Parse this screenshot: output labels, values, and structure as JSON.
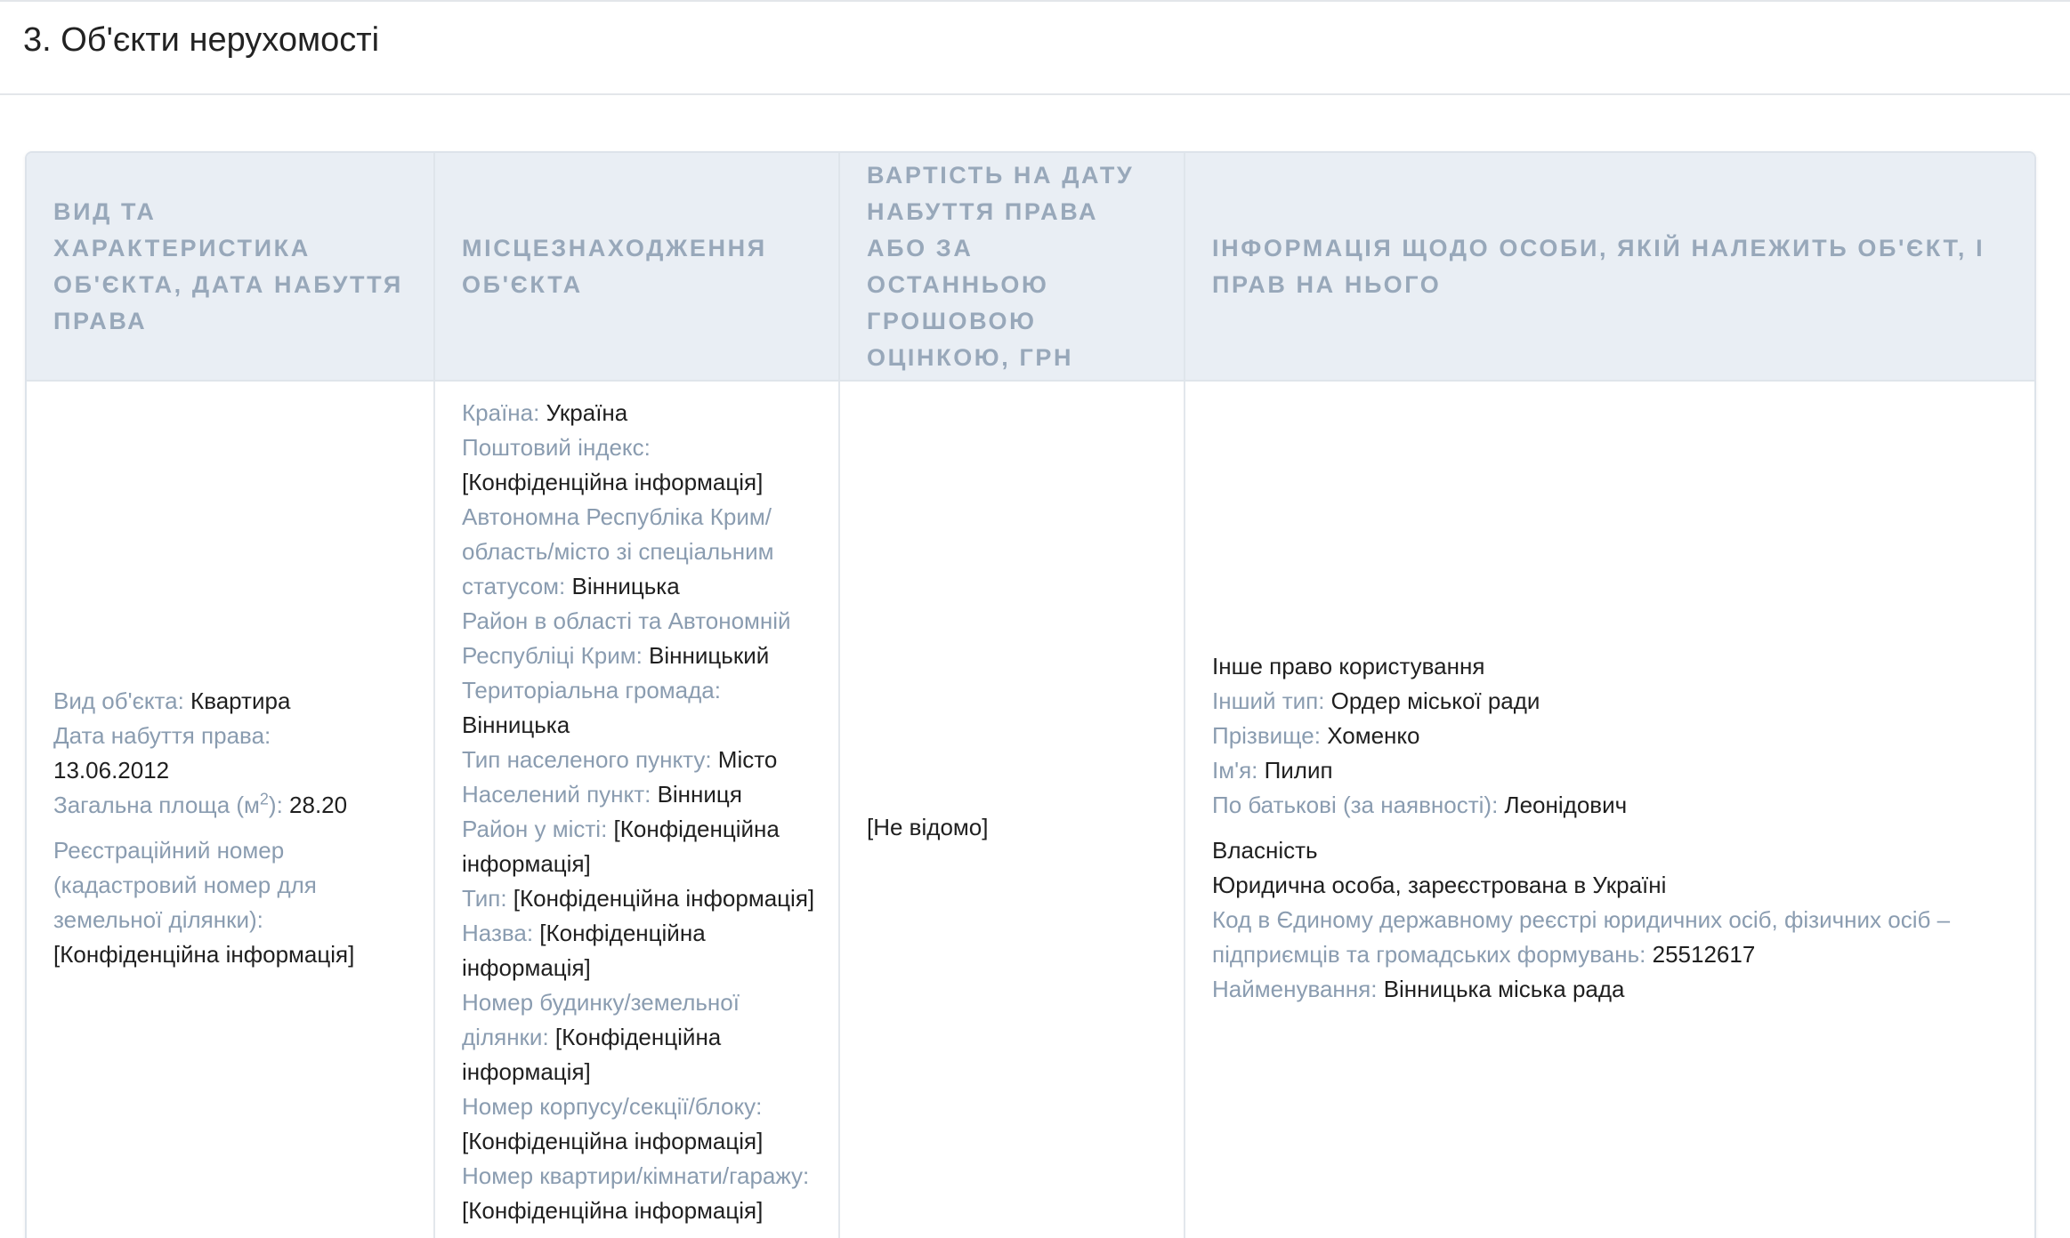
{
  "section": {
    "title": "3. Об'єкти нерухомості"
  },
  "table": {
    "headers": [
      "ВИД ТА ХАРАКТЕРИСТИКА ОБ'ЄКТА, ДАТА НАБУТТЯ ПРАВА",
      "МІСЦЕЗНАХОДЖЕННЯ ОБ'ЄКТА",
      "ВАРТІСТЬ НА ДАТУ НАБУТТЯ ПРАВА АБО ЗА ОСТАННЬОЮ ГРОШОВОЮ ОЦІНКОЮ, ГРН",
      "ІНФОРМАЦІЯ ЩОДО ОСОБИ, ЯКІЙ НАЛЕЖИТЬ ОБ'ЄКТ, І ПРАВ НА НЬОГО"
    ],
    "object": {
      "type_label": "Вид об'єкта: ",
      "type_value": "Квартира",
      "date_label": "Дата набуття права:",
      "date_value": "13.06.2012",
      "area_label_pre": "Загальна площа (м",
      "area_sup": "2",
      "area_label_post": "): ",
      "area_value": "28.20",
      "reg_label": "Реєстраційний номер (кадастровий номер для земельної ділянки):",
      "reg_value": "[Конфіденційна інформація]"
    },
    "location": {
      "country_label": "Країна: ",
      "country_value": "Україна",
      "postal_label": "Поштовий індекс: ",
      "postal_value": "[Конфіденційна інформація]",
      "region_label": "Автономна Республіка Крим/ область/місто зі спеціальним статусом: ",
      "region_value": "Вінницька",
      "district_label": "Район в області та Автономній Республіці Крим: ",
      "district_value": "Вінницький",
      "community_label": "Територіальна громада:",
      "community_value": "Вінницька",
      "settlement_type_label": "Тип населеного пункту: ",
      "settlement_type_value": "Місто",
      "settlement_label": "Населений пункт: ",
      "settlement_value": "Вінниця",
      "city_district_label": "Район у місті: ",
      "city_district_value": "[Конфіденційна інформація]",
      "street_type_label": "Тип: ",
      "street_type_value": "[Конфіденційна інформація]",
      "street_name_label": "Назва: ",
      "street_name_value": "[Конфіденційна інформація]",
      "house_label": "Номер будинку/земельної ділянки: ",
      "house_value": "[Конфіденційна інформація]",
      "block_label": "Номер корпусу/секції/блоку:",
      "block_value": "[Конфіденційна інформація]",
      "apt_label": "Номер квартири/кімнати/гаражу:",
      "apt_value": "[Конфіденційна інформація]"
    },
    "cost": {
      "value": "[Не відомо]"
    },
    "owner": {
      "right_type": "Інше право користування",
      "other_type_label": "Інший тип: ",
      "other_type_value": "Ордер міської ради",
      "surname_label": "Прізвище: ",
      "surname_value": "Хоменко",
      "name_label": "Ім'я: ",
      "name_value": "Пилип",
      "patronymic_label": "По батькові (за наявності): ",
      "patronymic_value": "Леонідович",
      "ownership": "Власність",
      "entity_type": "Юридична особа, зареєстрована в Україні",
      "code_label": "Код в Єдиному державному реєстрі юридичних осіб, фізичних осіб – підприємців та громадських формувань: ",
      "code_value": "25512617",
      "entity_name_label": "Найменування: ",
      "entity_name_value": "Вінницька міська рада"
    }
  }
}
